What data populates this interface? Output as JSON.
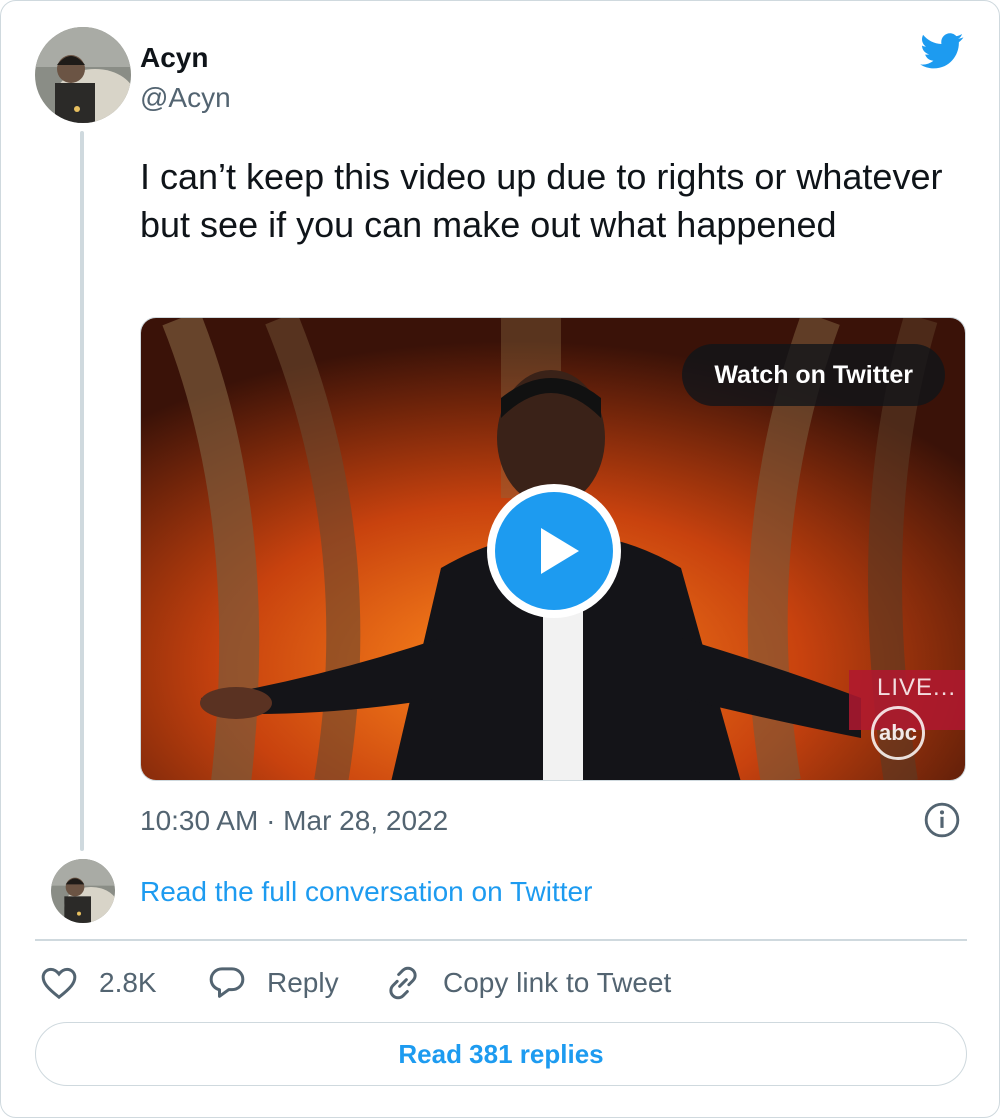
{
  "author": {
    "name": "Acyn",
    "handle": "@Acyn"
  },
  "tweet": {
    "text": "I can’t keep this video up due to rights or whatever but see if you can make out what happened",
    "timestamp": "10:30 AM · Mar 28, 2022"
  },
  "media": {
    "watch_label": "Watch on Twitter",
    "overlay_live": "LIVE...",
    "overlay_network": "abc"
  },
  "conversation": {
    "read_full_label": "Read the full conversation on Twitter"
  },
  "actions": {
    "like_count": "2.8K",
    "reply_label": "Reply",
    "copy_link_label": "Copy link to Tweet"
  },
  "footer": {
    "read_replies_label": "Read 381 replies"
  },
  "icons": {
    "brand": "twitter-bird-icon",
    "info": "info-icon",
    "like": "heart-icon",
    "reply": "speech-bubble-icon",
    "copy": "link-icon",
    "play": "play-icon"
  },
  "colors": {
    "accent": "#1d9bf0",
    "text": "#0f1419",
    "secondary": "#536471",
    "border": "#cfd9de"
  }
}
